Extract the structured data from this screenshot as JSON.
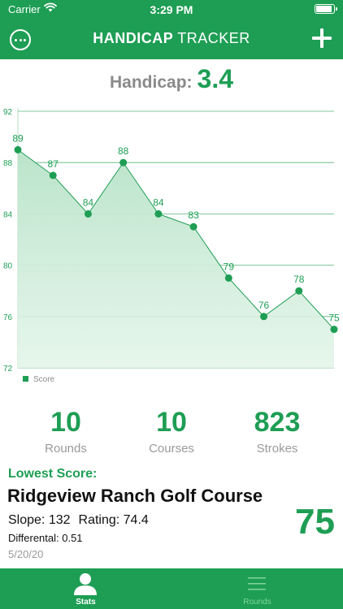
{
  "status_bar": {
    "carrier": "Carrier",
    "time": "3:29 PM",
    "battery_level": 0.95
  },
  "nav": {
    "title_bold": "HANDICAP",
    "title_light": "TRACKER",
    "left_icon": "more-horizontal-circle-icon",
    "right_icon": "plus-icon"
  },
  "handicap": {
    "label": "Handicap:",
    "value": "3.4"
  },
  "chart_data": {
    "type": "area",
    "title": "",
    "xlabel": "",
    "ylabel": "",
    "ylim": [
      72,
      92
    ],
    "y_ticks": [
      92,
      88,
      84,
      80,
      76,
      72
    ],
    "grid": true,
    "legend_position": "bottom-left",
    "series": [
      {
        "name": "Score",
        "values": [
          89,
          87,
          84,
          88,
          84,
          83,
          79,
          76,
          78,
          75
        ]
      }
    ]
  },
  "stats": [
    {
      "value": "10",
      "label": "Rounds"
    },
    {
      "value": "10",
      "label": "Courses"
    },
    {
      "value": "823",
      "label": "Strokes"
    }
  ],
  "lowest": {
    "heading": "Lowest Score:",
    "course": "Ridgeview Ranch Golf Course",
    "slope": "Slope: 132",
    "rating": "Rating: 74.4",
    "differential": "Differental: 0.51",
    "date": "5/20/20",
    "score": "75"
  },
  "tabs": [
    {
      "label": "Stats",
      "icon": "person-icon",
      "active": true
    },
    {
      "label": "Rounds",
      "icon": "list-icon",
      "active": false
    }
  ],
  "colors": {
    "brand": "#1e9e54",
    "fill": "#c9ebd5",
    "inactive_tab": "#7ed59d",
    "muted": "#9a9a9a"
  }
}
